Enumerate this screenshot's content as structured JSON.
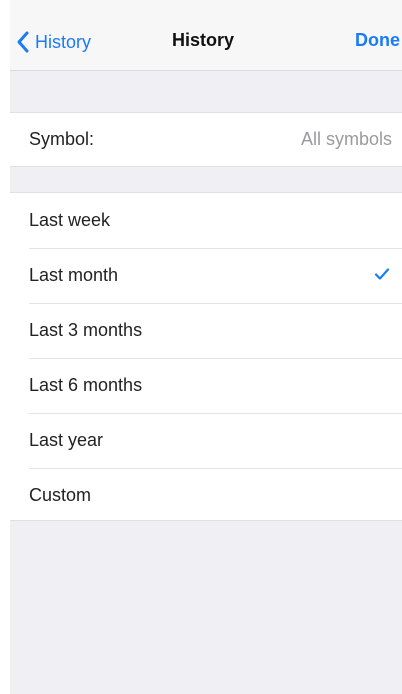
{
  "navbar": {
    "back_label": "History",
    "title": "History",
    "done_label": "Done"
  },
  "symbol_row": {
    "label": "Symbol:",
    "value": "All symbols"
  },
  "ranges": [
    {
      "label": "Last week",
      "selected": false
    },
    {
      "label": "Last month",
      "selected": true
    },
    {
      "label": "Last 3 months",
      "selected": false
    },
    {
      "label": "Last 6 months",
      "selected": false
    },
    {
      "label": "Last year",
      "selected": false
    },
    {
      "label": "Custom",
      "selected": false
    }
  ],
  "icons": {
    "back": "chevron-left-icon",
    "selected": "checkmark-icon"
  },
  "colors": {
    "accent": "#1a7cf5",
    "background": "#efeff4"
  }
}
